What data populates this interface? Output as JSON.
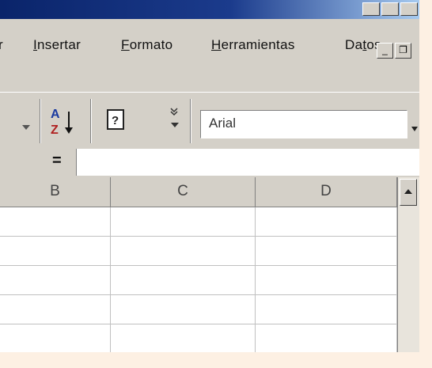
{
  "title_bar": {
    "title": ""
  },
  "menu": [
    {
      "pre": "",
      "ul": "",
      "post": "r"
    },
    {
      "pre": "",
      "ul": "I",
      "post": "nsertar"
    },
    {
      "pre": "",
      "ul": "F",
      "post": "ormato"
    },
    {
      "pre": "",
      "ul": "H",
      "post": "erramientas"
    },
    {
      "pre": "Da",
      "ul": "t",
      "post": "os"
    }
  ],
  "doc_controls": {
    "minimize": "_",
    "restore": "❐"
  },
  "toolbar": {
    "font_name": "Arial",
    "icons": [
      "dropdown-arrow-icon",
      "sort-ascending-icon",
      "help-icon",
      "more-buttons-icon",
      "font-dropdown-arrow-icon"
    ]
  },
  "formula_bar": {
    "equals_label": "=",
    "value": ""
  },
  "grid": {
    "columns": [
      "B",
      "C",
      "D"
    ],
    "rows": 5
  },
  "colors": {
    "title_bar_start": "#0a246a",
    "title_bar_end": "#a6caf0",
    "chrome": "#d4d0c8"
  }
}
